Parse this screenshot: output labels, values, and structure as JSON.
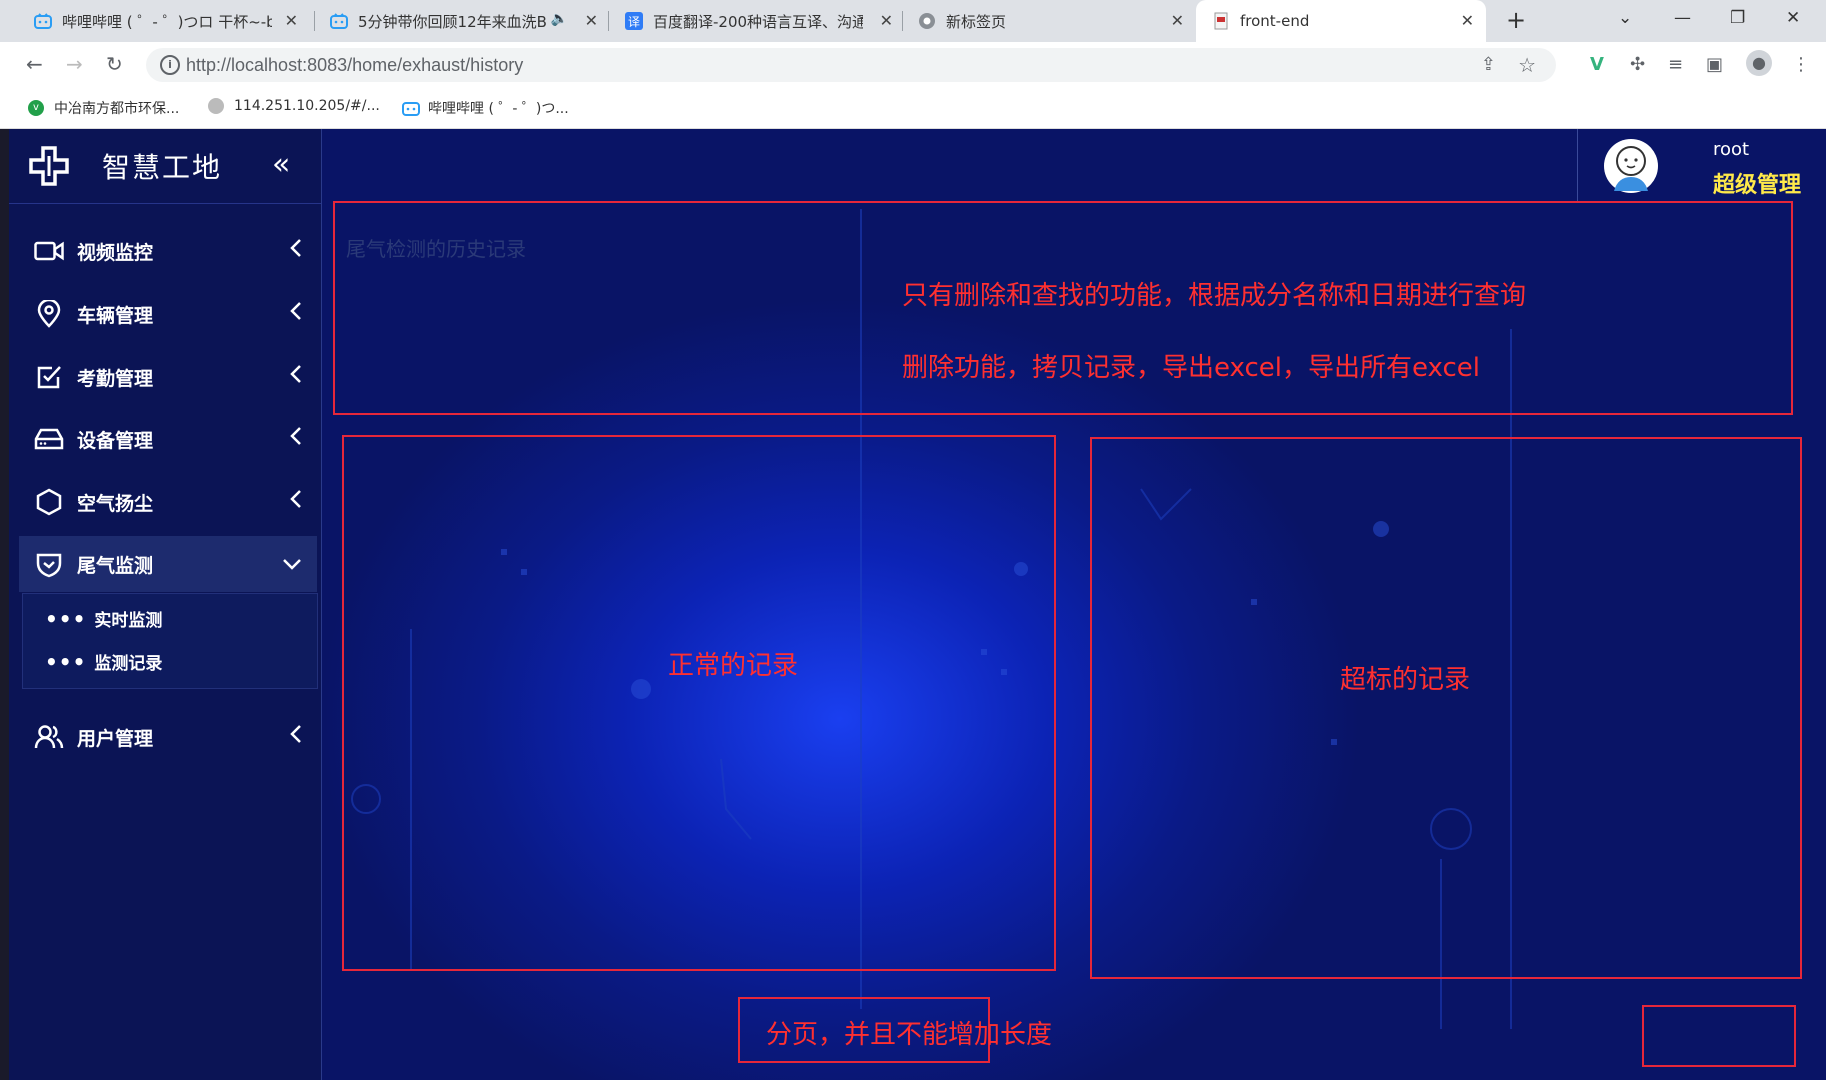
{
  "browser": {
    "tabs": [
      {
        "title": "哔哩哔哩 ( ゜- ゜)つロ 干杯~-bili",
        "icon": "bilibili-icon"
      },
      {
        "title": "5分钟带你回顾12年来血洗B",
        "icon": "bilibili-icon"
      },
      {
        "title": "百度翻译-200种语言互译、沟通",
        "icon": "translate-icon"
      },
      {
        "title": "新标签页",
        "icon": "chrome-icon"
      },
      {
        "title": "front-end",
        "icon": "page-icon"
      }
    ],
    "url": "http://localhost:8083/home/exhaust/history",
    "bookmarks": [
      {
        "label": "中冶南方都市环保..."
      },
      {
        "label": "114.251.10.205/#/..."
      },
      {
        "label": "哔哩哔哩 ( ゜- ゜)つ..."
      }
    ]
  },
  "app": {
    "title": "智慧工地",
    "menu": [
      {
        "label": "视频监控",
        "icon": "video-camera-icon"
      },
      {
        "label": "车辆管理",
        "icon": "location-pin-icon"
      },
      {
        "label": "考勤管理",
        "icon": "checkbox-icon"
      },
      {
        "label": "设备管理",
        "icon": "device-icon"
      },
      {
        "label": "空气扬尘",
        "icon": "hexagon-icon"
      },
      {
        "label": "尾气监测",
        "icon": "shield-check-icon",
        "open": true,
        "children": [
          {
            "label": "实时监测"
          },
          {
            "label": "监测记录"
          }
        ]
      },
      {
        "label": "用户管理",
        "icon": "users-icon"
      }
    ],
    "user": {
      "name": "root",
      "role": "超级管理"
    },
    "page_caption": "尾气检测的历史记录"
  },
  "annotations": {
    "top_line1": "只有删除和查找的功能，根据成分名称和日期进行查询",
    "top_line2": "删除功能，拷贝记录，导出excel，导出所有excel",
    "left_panel": "正常的记录",
    "right_panel": "超标的记录",
    "pagination": "分页，并且不能增加长度"
  },
  "colors": {
    "annotation_red": "#e6273a",
    "role_yellow": "#ffe94a",
    "sidebar_bg": "#0b1455"
  }
}
